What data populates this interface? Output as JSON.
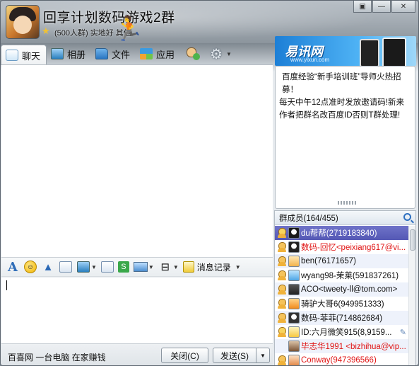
{
  "window": {
    "title": "回享计划数码游戏2群",
    "subtitle": "(500人群) 实地好 其他",
    "controls": {
      "restore_label": "▣",
      "minimize_label": "—",
      "close_label": "✕"
    }
  },
  "tabs": [
    {
      "label": "聊天",
      "icon": "chat-icon",
      "active": true
    },
    {
      "label": "相册",
      "icon": "photo-album-icon"
    },
    {
      "label": "文件",
      "icon": "folder-icon"
    },
    {
      "label": "应用",
      "icon": "app-grid-icon"
    }
  ],
  "ad": {
    "brand": "易讯网",
    "url": "www.yixun.com"
  },
  "notice": {
    "line1": "百度经验“新手培训班”导师火热招募！",
    "line2": "每天中午12点准时发放邀请码!新来作者把群名改百度ID否则T群处理!"
  },
  "members": {
    "header": "群成员(164/455)",
    "list": [
      {
        "name": "du帮帮(2719183840)",
        "role": "owner",
        "color": "white",
        "selected": true
      },
      {
        "name": "数码-回忆<peixiang617@vi...",
        "role": "admin",
        "color": "red"
      },
      {
        "name": "ben(76171657)",
        "role": "admin",
        "color": "black"
      },
      {
        "name": "wyang98-茉莱(591837261)",
        "role": "admin",
        "color": "black"
      },
      {
        "name": "ACO<tweety-ll@tom.com>",
        "role": "admin",
        "color": "black"
      },
      {
        "name": "骑驴大哥6(949951333)",
        "role": "admin",
        "color": "black"
      },
      {
        "name": "数码-菲菲(714862684)",
        "role": "admin",
        "color": "black"
      },
      {
        "name": "ID:六月微笑915(8,9159...",
        "role": "admin",
        "color": "black",
        "editable": true
      },
      {
        "name": "毕志华1991 <bizhihua@vip...",
        "role": "member",
        "color": "red"
      },
      {
        "name": "Conway(947396566)",
        "role": "admin",
        "color": "red"
      }
    ]
  },
  "toolbar": {
    "msglog_label": "消息记录"
  },
  "bottom": {
    "link": "百喜网 一台电脑 在家赚钱",
    "close_label": "关闭(C)",
    "send_label": "发送(S)",
    "send_dropdown": "▼"
  }
}
